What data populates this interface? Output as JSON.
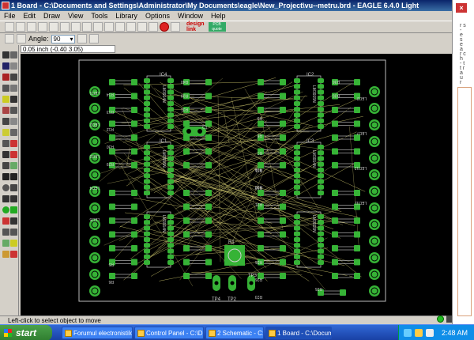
{
  "window": {
    "title": "1 Board - C:\\Documents and Settings\\Administrator\\My Documents\\eagle\\New_Project\\vu--metru.brd - EAGLE 6.4.0 Light"
  },
  "menu": [
    "File",
    "Edit",
    "Draw",
    "View",
    "Tools",
    "Library",
    "Options",
    "Window",
    "Help"
  ],
  "toolbar2": {
    "angle_label": "Angle:",
    "angle_value": "90"
  },
  "coordinates": "0.05 inch (-0.40 3.05)",
  "status_text": "Left-click to select object to move",
  "taskbar": {
    "start": "start",
    "tasks": [
      "Forumul electronistilo...",
      "Control Panel - C:\\Do...",
      "2 Schematic - C:\\Do...",
      "1 Board - C:\\Docume..."
    ],
    "clock": "2:48 AM"
  },
  "board": {
    "ic_labels": [
      "IC4",
      "IC3",
      "IC2",
      "IC1"
    ],
    "ic_inner": [
      "LM3914N",
      "LM3915N"
    ],
    "r_top_left": [
      "R40",
      "R39",
      "R31"
    ],
    "r_top_right": [
      "R36",
      "R35"
    ],
    "r_mid_left": [
      "R14",
      "R13",
      "R12",
      "R30",
      "R29"
    ],
    "r_mid_right": [
      "R9",
      "R8",
      "R7",
      "R11",
      "R10"
    ],
    "r_low_right": [
      "R19",
      "R20",
      "R21"
    ],
    "r_bottom_left": [
      "R5",
      "R6"
    ],
    "r_bottom_right": [
      "R25",
      "R26",
      "R23"
    ],
    "r_center": "R1",
    "c_label": "C1",
    "tp_labels": [
      "TP4",
      "TP2",
      "TP3"
    ],
    "led_left": [
      "LED1",
      "LED2",
      "LED3",
      "LED4",
      "LED5"
    ],
    "led_right": [
      "LED2",
      "LED7",
      "LED12",
      "LED11"
    ]
  },
  "behind_text": "r s - e s e a r c h - t t r a u r"
}
